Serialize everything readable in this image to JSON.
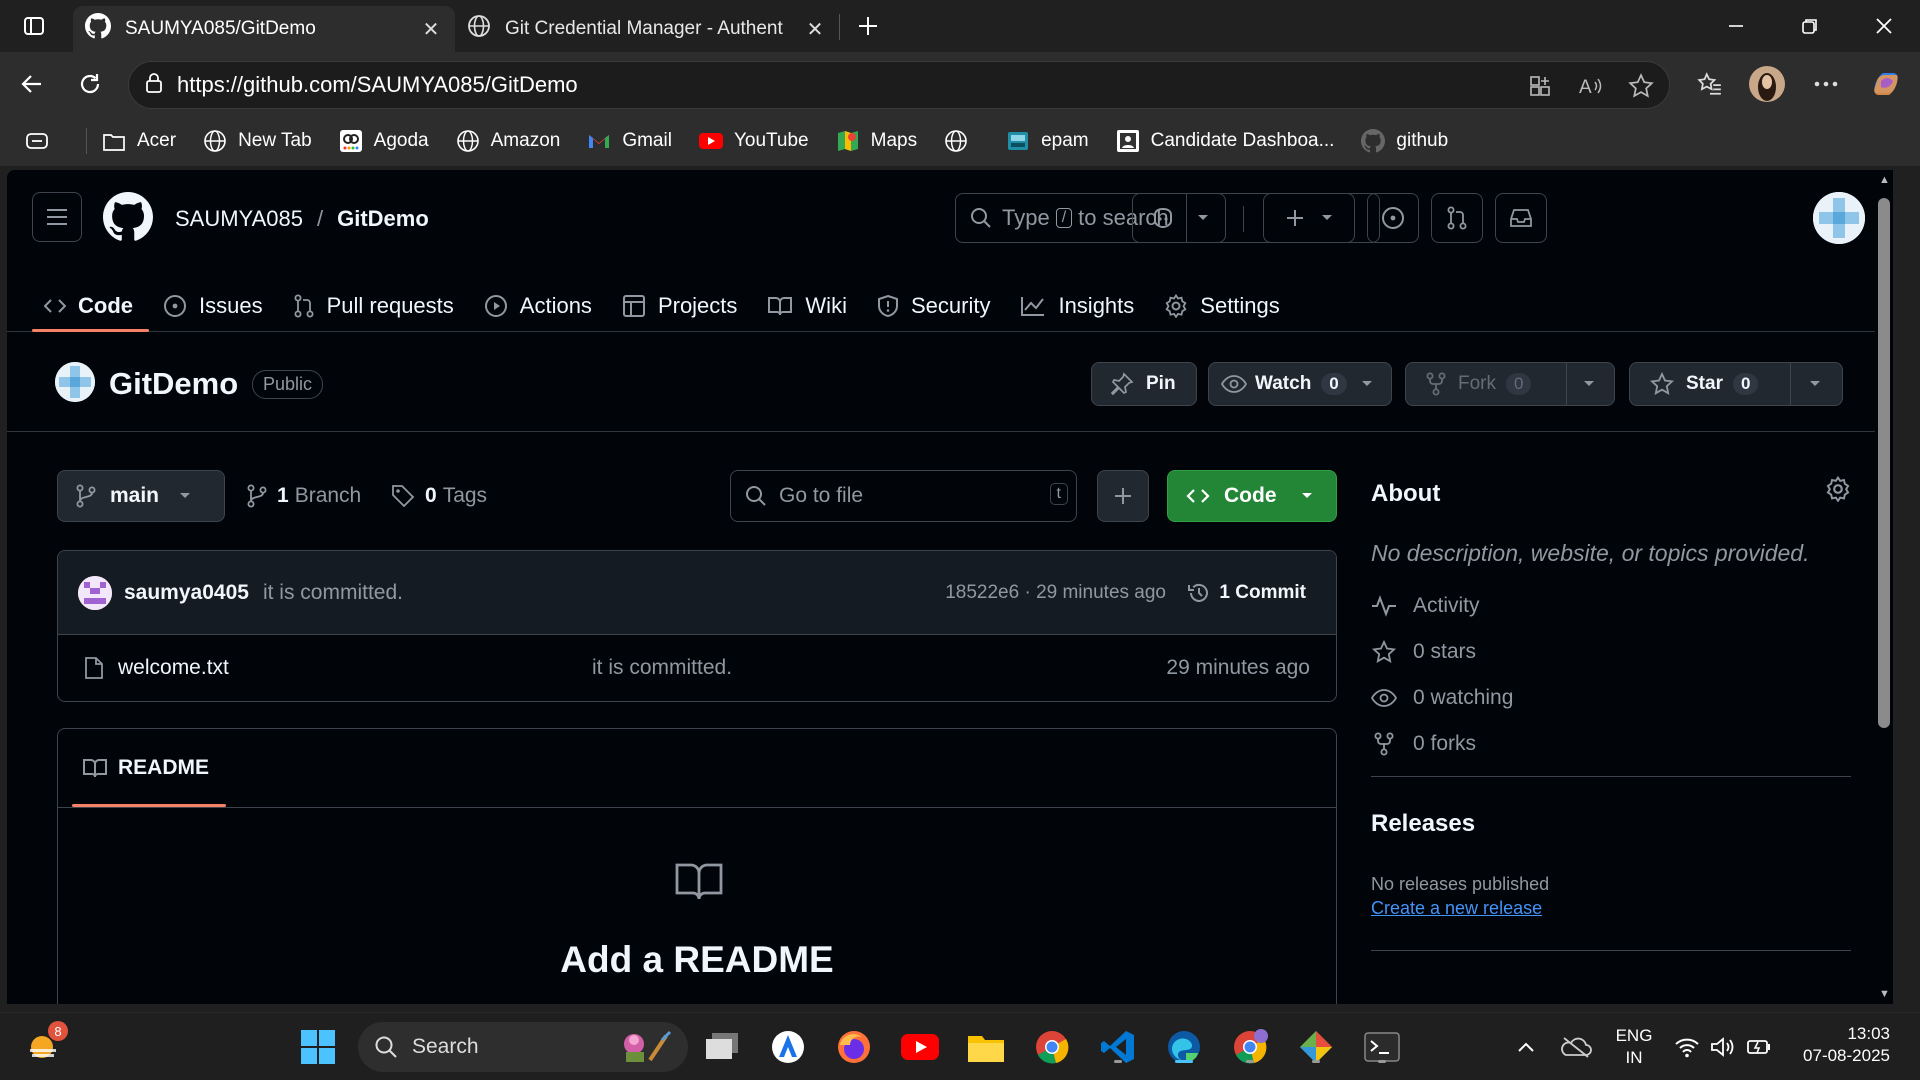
{
  "browser": {
    "tabs": [
      {
        "title": "SAUMYA085/GitDemo",
        "active": true
      },
      {
        "title": "Git Credential Manager - Authent",
        "active": false
      }
    ],
    "url": "https://github.com/SAUMYA085/GitDemo",
    "bookmarks": [
      "Acer",
      "New Tab",
      "Agoda",
      "Amazon",
      "Gmail",
      "YouTube",
      "Maps",
      "",
      "epam",
      "Candidate Dashboa...",
      "github"
    ]
  },
  "github": {
    "owner": "SAUMYA085",
    "repo": "GitDemo",
    "search_prefix": "Type",
    "search_key": "/",
    "search_suffix": "to search",
    "nav": [
      {
        "label": "Code",
        "icon": "code-icon"
      },
      {
        "label": "Issues",
        "icon": "issue-icon"
      },
      {
        "label": "Pull requests",
        "icon": "pull-request-icon"
      },
      {
        "label": "Actions",
        "icon": "play-icon"
      },
      {
        "label": "Projects",
        "icon": "table-icon"
      },
      {
        "label": "Wiki",
        "icon": "book-icon"
      },
      {
        "label": "Security",
        "icon": "shield-icon"
      },
      {
        "label": "Insights",
        "icon": "graph-icon"
      },
      {
        "label": "Settings",
        "icon": "gear-icon"
      }
    ],
    "visibility": "Public",
    "actions": {
      "pin": "Pin",
      "watch": "Watch",
      "watch_count": "0",
      "fork": "Fork",
      "fork_count": "0",
      "star": "Star",
      "star_count": "0"
    },
    "branch": "main",
    "branch_count": "1",
    "branch_label": "Branch",
    "tag_count": "0",
    "tag_label": "Tags",
    "goto_placeholder": "Go to file",
    "goto_key": "t",
    "code_button": "Code",
    "commit": {
      "user": "saumya0405",
      "message": "it is committed.",
      "meta": "18522e6 · 29 minutes ago",
      "count_label": "1 Commit"
    },
    "files": [
      {
        "name": "welcome.txt",
        "message": "it is committed.",
        "time": "29 minutes ago"
      }
    ],
    "readme_tab": "README",
    "readme_heading": "Add a README",
    "about": {
      "title": "About",
      "description": "No description, website, or topics provided.",
      "activity": "Activity",
      "stars": "0 stars",
      "watching": "0 watching",
      "forks": "0 forks"
    },
    "releases": {
      "title": "Releases",
      "none": "No releases published",
      "create": "Create a new release"
    }
  },
  "taskbar": {
    "notification_count": "8",
    "search": "Search",
    "lang_line1": "ENG",
    "lang_line2": "IN",
    "time": "13:03",
    "date": "07-08-2025"
  },
  "colors": {
    "accent_green": "#238636",
    "tab_underline": "#f78166",
    "link": "#4493f8",
    "page_bg": "#010409"
  }
}
